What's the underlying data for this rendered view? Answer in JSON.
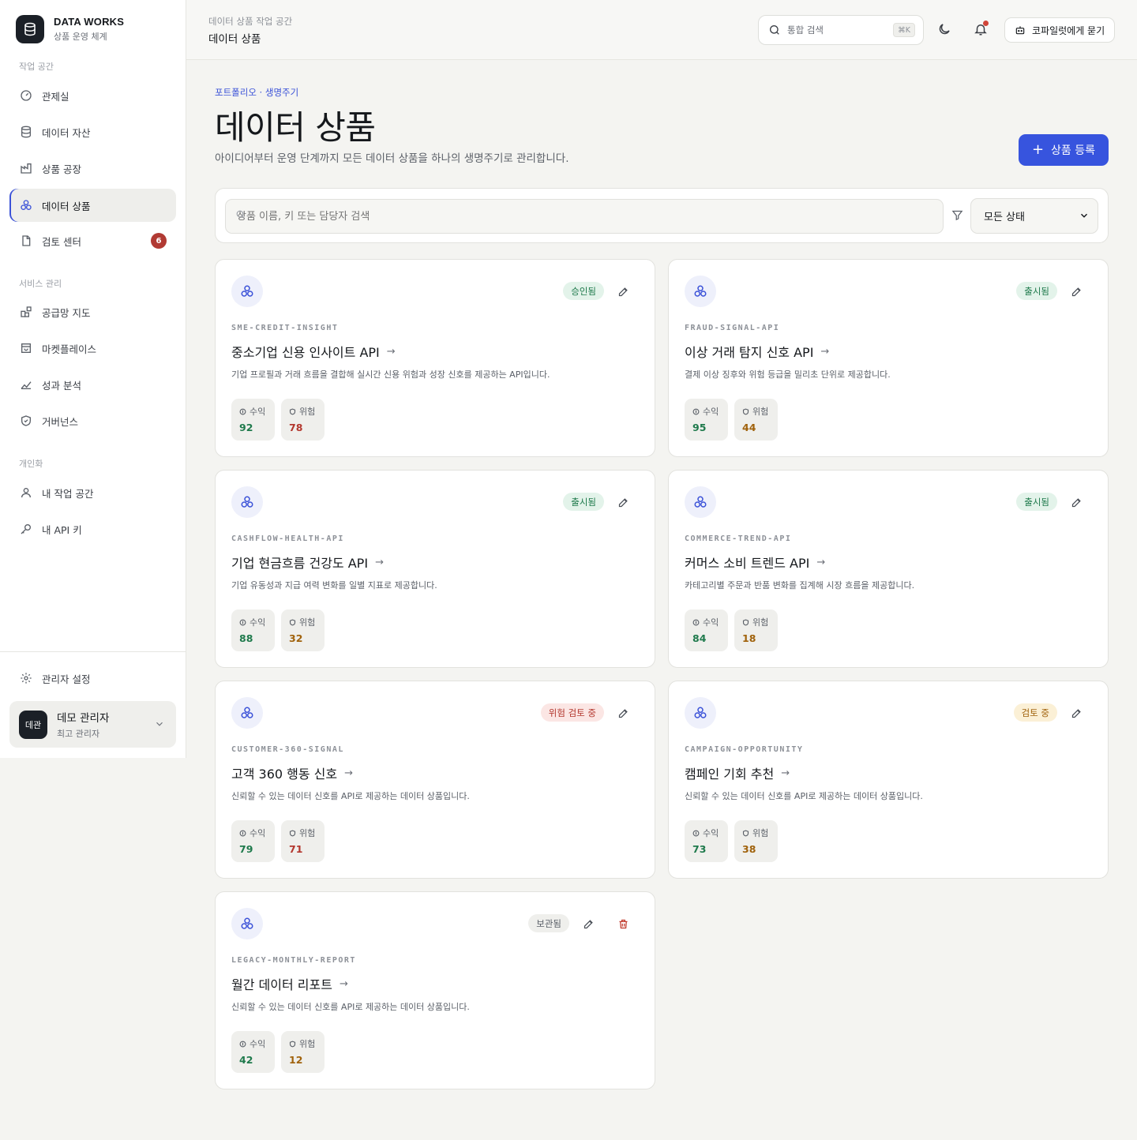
{
  "brand": {
    "name": "DATA WORKS",
    "subtitle": "상품 운영 체계"
  },
  "sidebar": {
    "sections": [
      {
        "label": "작업 공간"
      },
      {
        "label": "서비스 관리"
      },
      {
        "label": "개인화"
      }
    ],
    "items": [
      {
        "label": "관제실",
        "icon": "gauge-icon"
      },
      {
        "label": "데이터 자산",
        "icon": "database-icon"
      },
      {
        "label": "상품 공장",
        "icon": "factory-icon"
      },
      {
        "label": "데이터 상품",
        "icon": "cubes-icon",
        "active": true
      },
      {
        "label": "검토 센터",
        "icon": "document-icon",
        "badge": "6"
      },
      {
        "label": "공급망 지도",
        "icon": "blocks-icon"
      },
      {
        "label": "마켓플레이스",
        "icon": "store-icon"
      },
      {
        "label": "성과 분석",
        "icon": "chart-icon"
      },
      {
        "label": "거버넌스",
        "icon": "shield-icon"
      },
      {
        "label": "내 작업 공간",
        "icon": "user-icon"
      },
      {
        "label": "내 API 키",
        "icon": "key-icon"
      }
    ],
    "settings_label": "관리자 설정",
    "user": {
      "avatar": "데관",
      "name": "데모 관리자",
      "role": "최고 관리자"
    }
  },
  "topbar": {
    "breadcrumb_parent": "데이터 상품 작업 공간",
    "breadcrumb_current": "데이터 상품",
    "search_placeholder": "통합 검색",
    "search_shortcut": "⌘K",
    "copilot_label": "코파일럿에게 묻기"
  },
  "header": {
    "eyebrow": "포트폴리오 · 생명주기",
    "title": "데이터 상품",
    "description": "아이디어부터 운영 단계까지 모든 데이터 상품을 하나의 생명주기로 관리합니다.",
    "primary_button": "상품 등록"
  },
  "filters": {
    "search_placeholder": "상품 이름, 키 또는 담당자 검색",
    "status_selected": "모든 상태"
  },
  "metric_labels": {
    "revenue": "수익",
    "risk": "위험"
  },
  "products": [
    {
      "key": "SME-CREDIT-INSIGHT",
      "title": "중소기업 신용 인사이트 API",
      "description": "기업 프로필과 거래 흐름을 결합해 실시간 신용 위험과 성장 신호를 제공하는 API입니다.",
      "status": "승인됨",
      "status_kind": "approved",
      "revenue": "92",
      "risk": "78",
      "risk_color": "#b3372e"
    },
    {
      "key": "FRAUD-SIGNAL-API",
      "title": "이상 거래 탐지 신호 API",
      "description": "결제 이상 징후와 위험 등급을 밀리초 단위로 제공합니다.",
      "status": "출시됨",
      "status_kind": "released",
      "revenue": "95",
      "risk": "44",
      "risk_color": "#a0620c"
    },
    {
      "key": "CASHFLOW-HEALTH-API",
      "title": "기업 현금흐름 건강도 API",
      "description": "기업 유동성과 지급 여력 변화를 일별 지표로 제공합니다.",
      "status": "출시됨",
      "status_kind": "released",
      "revenue": "88",
      "risk": "32",
      "risk_color": "#a0620c"
    },
    {
      "key": "COMMERCE-TREND-API",
      "title": "커머스 소비 트렌드 API",
      "description": "카테고리별 주문과 반품 변화를 집계해 시장 흐름을 제공합니다.",
      "status": "출시됨",
      "status_kind": "released",
      "revenue": "84",
      "risk": "18",
      "risk_color": "#a0620c"
    },
    {
      "key": "CUSTOMER-360-SIGNAL",
      "title": "고객 360 행동 신호",
      "description": "신뢰할 수 있는 데이터 신호를 API로 제공하는 데이터 상품입니다.",
      "status": "위험 검토 중",
      "status_kind": "risk",
      "revenue": "79",
      "risk": "71",
      "risk_color": "#b3372e"
    },
    {
      "key": "CAMPAIGN-OPPORTUNITY",
      "title": "캠페인 기회 추천",
      "description": "신뢰할 수 있는 데이터 신호를 API로 제공하는 데이터 상품입니다.",
      "status": "검토 중",
      "status_kind": "review",
      "revenue": "73",
      "risk": "38",
      "risk_color": "#a0620c"
    },
    {
      "key": "LEGACY-MONTHLY-REPORT",
      "title": "월간 데이터 리포트",
      "description": "신뢰할 수 있는 데이터 신호를 API로 제공하는 데이터 상품입니다.",
      "status": "보관됨",
      "status_kind": "archived",
      "revenue": "42",
      "risk": "12",
      "risk_color": "#a0620c",
      "deletable": true
    }
  ]
}
